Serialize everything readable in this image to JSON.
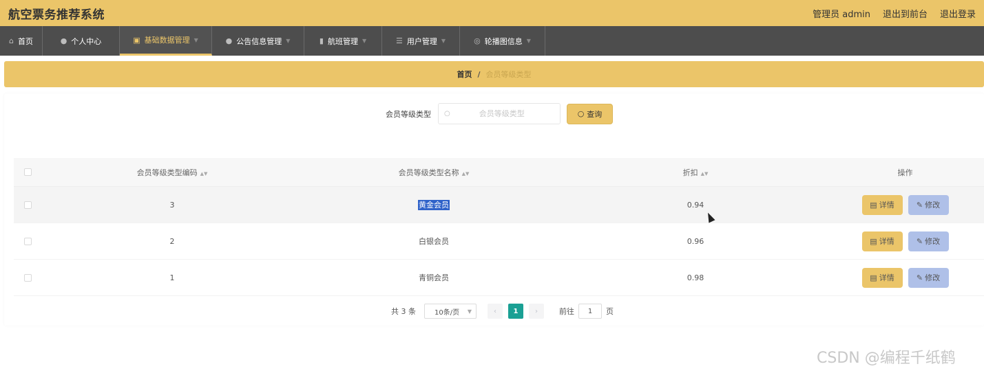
{
  "header": {
    "app_title": "航空票务推荐系统",
    "admin_label": "管理员 admin",
    "link_frontend": "退出到前台",
    "link_logout": "退出登录"
  },
  "nav": {
    "items": [
      {
        "label": "首页",
        "icon": "home-icon"
      },
      {
        "label": "个人中心",
        "icon": "user-icon"
      },
      {
        "label": "基础数据管理",
        "icon": "grid-icon"
      },
      {
        "label": "公告信息管理",
        "icon": "user-icon"
      },
      {
        "label": "航班管理",
        "icon": "mic-icon"
      },
      {
        "label": "用户管理",
        "icon": "list-icon"
      },
      {
        "label": "轮播图信息",
        "icon": "globe-icon"
      }
    ],
    "active_index": 2
  },
  "breadcrumb": {
    "home": "首页",
    "separator": "/",
    "current": "会员等级类型"
  },
  "search": {
    "label": "会员等级类型",
    "placeholder": "会员等级类型",
    "button": "查询"
  },
  "table": {
    "columns": [
      "会员等级类型编码",
      "会员等级类型名称",
      "折扣",
      "操作"
    ],
    "rows": [
      {
        "code": "3",
        "name": "黄金会员",
        "discount": "0.94"
      },
      {
        "code": "2",
        "name": "白银会员",
        "discount": "0.96"
      },
      {
        "code": "1",
        "name": "青铜会员",
        "discount": "0.98"
      }
    ],
    "detail_label": "详情",
    "edit_label": "修改"
  },
  "pagination": {
    "total": "共 3 条",
    "page_size": "10条/页",
    "current_page": "1",
    "goto_label": "前往",
    "goto_value": "1",
    "page_word": "页"
  },
  "watermark": "CSDN @编程千纸鹤",
  "colors": {
    "accent": "#ebc569",
    "nav_bg": "#4d4d4d",
    "edit_button": "#afc0e8",
    "page_active": "#1aa094"
  }
}
